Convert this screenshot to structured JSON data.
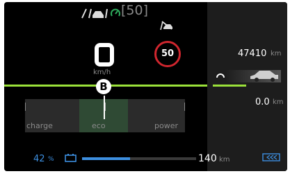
{
  "top_status": {
    "speed_limit_set": "[50]"
  },
  "speed": {
    "value": "0",
    "unit": "km/h"
  },
  "speed_limit_sign": "50",
  "gear": "B",
  "power_meter": {
    "labels": [
      "charge",
      "eco",
      "power"
    ]
  },
  "odometer": {
    "value": "47410",
    "unit": "km"
  },
  "trip": {
    "value": "0.0",
    "unit": "km"
  },
  "battery": {
    "percent": "42",
    "percent_unit": "%",
    "level_fraction": 0.42
  },
  "range": {
    "value": "140",
    "unit": "km"
  },
  "colors": {
    "accent_green": "#9be23a",
    "battery_blue": "#3d8fe0",
    "sign_red": "#d0262e"
  },
  "icons": [
    "adas-car-icon",
    "cruise-gauge-icon",
    "no-lane-assist-icon",
    "car-side-icon",
    "reset-loop-icon",
    "battery-icon",
    "regen-icon"
  ]
}
